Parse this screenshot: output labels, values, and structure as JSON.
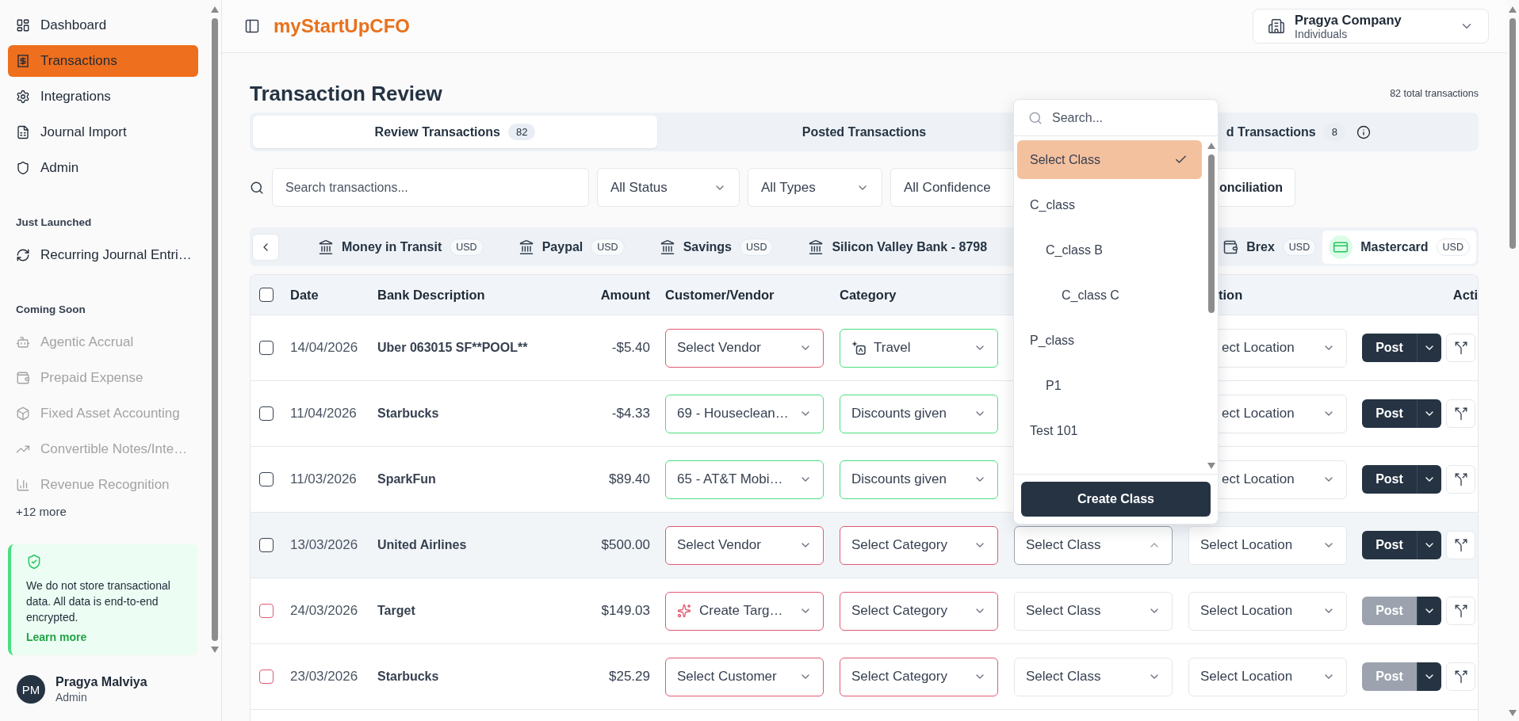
{
  "sidebar": {
    "items": [
      {
        "label": "Dashboard",
        "selected": false
      },
      {
        "label": "Transactions",
        "selected": true
      },
      {
        "label": "Integrations",
        "selected": false
      },
      {
        "label": "Journal Import",
        "selected": false
      },
      {
        "label": "Admin",
        "selected": false
      }
    ],
    "sections": [
      {
        "title": "Just Launched",
        "items": [
          {
            "label": "Recurring Journal Entri…",
            "disabled": false
          }
        ]
      },
      {
        "title": "Coming Soon",
        "items": [
          {
            "label": "Agentic Accrual",
            "disabled": true
          },
          {
            "label": "Prepaid Expense",
            "disabled": true
          },
          {
            "label": "Fixed Asset Accounting",
            "disabled": true
          },
          {
            "label": "Convertible Notes/Inte…",
            "disabled": true
          },
          {
            "label": "Revenue Recognition",
            "disabled": true
          }
        ],
        "more": "+12 more"
      }
    ],
    "notice": {
      "text": "We do not store transactional data. All data is end-to-end encrypted.",
      "link": "Learn more"
    },
    "user": {
      "initials": "PM",
      "name": "Pragya Malviya",
      "role": "Admin"
    }
  },
  "header": {
    "logo": "myStartUpCFO",
    "company": {
      "name": "Pragya Company",
      "subtitle": "Individuals"
    }
  },
  "page": {
    "title": "Transaction Review",
    "total": "82 total transactions"
  },
  "tabs": [
    {
      "label": "Review Transactions",
      "count": "82",
      "selected": true,
      "kind": "tab"
    },
    {
      "label": "Posted Transactions",
      "selected": false,
      "kind": "tab"
    },
    {
      "label": "d Transactions",
      "count": "8",
      "info": true,
      "selected": false,
      "kind": "clipped"
    }
  ],
  "filters": {
    "search": {
      "placeholder": "Search transactions..."
    },
    "selects": [
      {
        "value": "All Status",
        "kind": "select"
      },
      {
        "value": "All Types",
        "kind": "select"
      },
      {
        "value": "All Confidence",
        "kind": "clipped"
      }
    ],
    "button": "onciliation"
  },
  "account_tabs": {
    "left_group": [
      {
        "name": "Money in Transit",
        "currency": "USD",
        "kind": "bank",
        "selected": false
      },
      {
        "name": "Paypal",
        "currency": "USD",
        "kind": "bank",
        "selected": false
      },
      {
        "name": "Savings",
        "currency": "USD",
        "kind": "bank",
        "selected": false
      },
      {
        "name": "Silicon Valley Bank - 8798",
        "kind": "bank",
        "selected": false
      }
    ],
    "right_group": [
      {
        "name": "Brex",
        "currency": "USD",
        "kind": "wallet",
        "selected": false
      },
      {
        "name": "Mastercard",
        "currency": "USD",
        "kind": "card",
        "selected": true
      }
    ]
  },
  "table": {
    "select_all": {
      "checked": false
    },
    "columns": [
      {
        "label": "Date",
        "kind": "text"
      },
      {
        "label": "Bank Description",
        "kind": "text"
      },
      {
        "label": "Amount",
        "kind": "number"
      },
      {
        "label": "Customer/Vendor",
        "kind": "field"
      },
      {
        "label": "Category",
        "kind": "field"
      },
      {
        "label": "tion",
        "kind": "clipped-left"
      },
      {
        "label": "Acti",
        "kind": "clipped-right"
      }
    ],
    "rows": [
      {
        "kind": "ready",
        "checked": false,
        "highlighted": false,
        "date": "14/04/2026",
        "description": "Uber 063015 SF**POOL**",
        "amount": "-$5.40",
        "party": {
          "value": "Select Vendor",
          "error": true,
          "kind": "select"
        },
        "category": {
          "value": "Travel",
          "error": false,
          "kind": "ai"
        },
        "location": {
          "value": "ect Location",
          "kind": "clipped"
        },
        "post": {
          "label": "Post",
          "disabled": false
        }
      },
      {
        "kind": "ready",
        "checked": false,
        "highlighted": false,
        "date": "11/04/2026",
        "description": "Starbucks",
        "amount": "-$4.33",
        "party": {
          "value": "69 - Houseclean…",
          "error": false,
          "kind": "select"
        },
        "category": {
          "value": "Discounts given",
          "error": false,
          "kind": "select"
        },
        "location": {
          "value": "ect Location",
          "kind": "clipped"
        },
        "post": {
          "label": "Post",
          "disabled": false
        }
      },
      {
        "kind": "ready",
        "checked": false,
        "highlighted": false,
        "date": "11/03/2026",
        "description": "SparkFun",
        "amount": "$89.40",
        "party": {
          "value": "65 - AT&T Mobi…",
          "error": false,
          "kind": "select"
        },
        "category": {
          "value": "Discounts given",
          "error": false,
          "kind": "select"
        },
        "location": {
          "value": "ect Location",
          "kind": "clipped"
        },
        "post": {
          "label": "Post",
          "disabled": false
        }
      },
      {
        "kind": "ready",
        "checked": false,
        "highlighted": true,
        "date": "13/03/2026",
        "description": "United Airlines",
        "amount": "$500.00",
        "party": {
          "value": "Select Vendor",
          "error": true,
          "kind": "select"
        },
        "category": {
          "value": "Select Category",
          "error": true,
          "kind": "select"
        },
        "class": {
          "value": "Select Class",
          "open": true
        },
        "location": {
          "value": "Select Location",
          "kind": "select"
        },
        "post": {
          "label": "Post",
          "disabled": false
        }
      },
      {
        "kind": "blocked",
        "checked": false,
        "highlighted": false,
        "date": "24/03/2026",
        "description": "Target",
        "amount": "$149.03",
        "party": {
          "value": "Create Targ…",
          "error": true,
          "kind": "suggestion"
        },
        "category": {
          "value": "Select Category",
          "error": true,
          "kind": "select"
        },
        "class": {
          "value": "Select Class",
          "open": false
        },
        "location": {
          "value": "Select Location",
          "kind": "select"
        },
        "post": {
          "label": "Post",
          "disabled": true
        }
      },
      {
        "kind": "blocked",
        "checked": false,
        "highlighted": false,
        "date": "23/03/2026",
        "description": "Starbucks",
        "amount": "$25.29",
        "party": {
          "value": "Select Customer",
          "error": true,
          "kind": "select"
        },
        "category": {
          "value": "Select Category",
          "error": true,
          "kind": "select"
        },
        "class": {
          "value": "Select Class",
          "open": false
        },
        "location": {
          "value": "Select Location",
          "kind": "select"
        },
        "post": {
          "label": "Post",
          "disabled": true
        }
      }
    ]
  },
  "class_menu": {
    "search": {
      "placeholder": "Search..."
    },
    "options": [
      {
        "label": "Select Class",
        "selected": true
      },
      {
        "label": "C_class",
        "selected": false,
        "children": [
          {
            "label": "C_class B",
            "selected": false,
            "children": [
              {
                "label": "C_class C",
                "selected": false
              }
            ]
          }
        ]
      },
      {
        "label": "P_class",
        "selected": false,
        "children": [
          {
            "label": "P1",
            "selected": false
          }
        ]
      },
      {
        "label": "Test 101",
        "selected": false
      }
    ],
    "button": "Create Class"
  }
}
